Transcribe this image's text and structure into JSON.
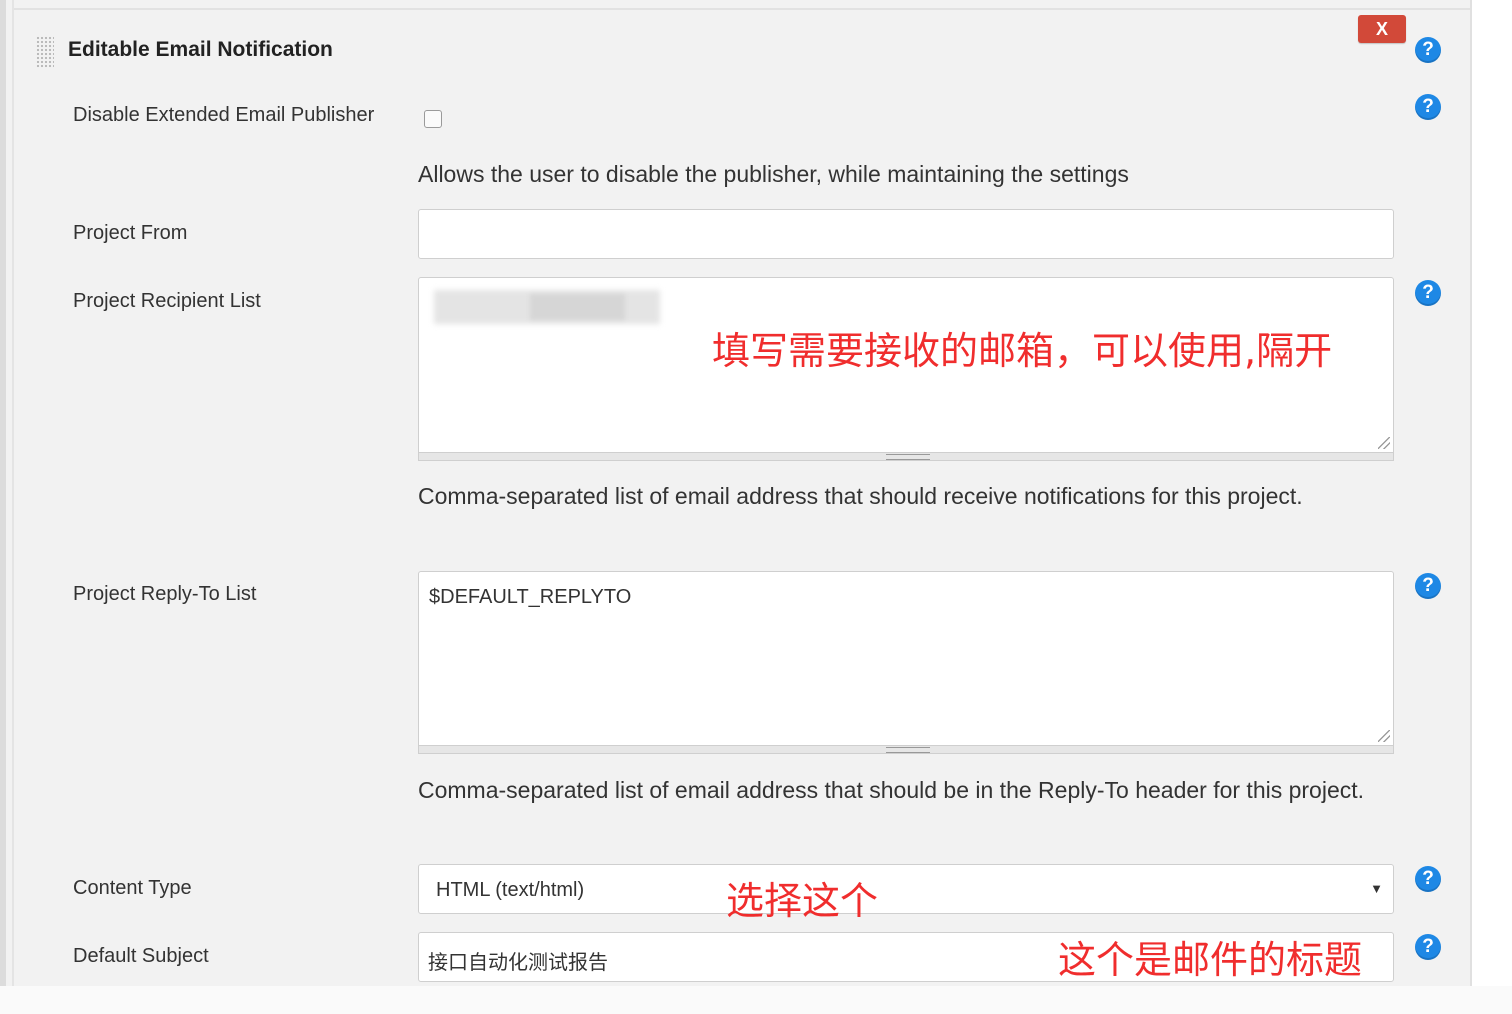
{
  "section": {
    "title": "Editable Email Notification",
    "delete_label": "X",
    "help_label": "?"
  },
  "disable_publisher": {
    "label": "Disable Extended Email Publisher",
    "checked": false,
    "description": "Allows the user to disable the publisher, while maintaining the settings"
  },
  "project_from": {
    "label": "Project From",
    "value": ""
  },
  "recipient_list": {
    "label": "Project Recipient List",
    "annotation": "填写需要接收的邮箱，可以使用,隔开",
    "description": "Comma-separated list of email address that should receive notifications for this project."
  },
  "reply_to": {
    "label": "Project Reply-To List",
    "value": "$DEFAULT_REPLYTO",
    "description": "Comma-separated list of email address that should be in the Reply-To header for this project."
  },
  "content_type": {
    "label": "Content Type",
    "selected": "HTML (text/html)",
    "annotation": "选择这个"
  },
  "default_subject": {
    "label": "Default Subject",
    "value": "接口自动化测试报告",
    "annotation": "这个是邮件的标题"
  },
  "colors": {
    "panel_bg": "#f2f2f2",
    "help_blue": "#1e88e5",
    "delete_red": "#d24939",
    "annotation_red": "#f02d2d"
  }
}
